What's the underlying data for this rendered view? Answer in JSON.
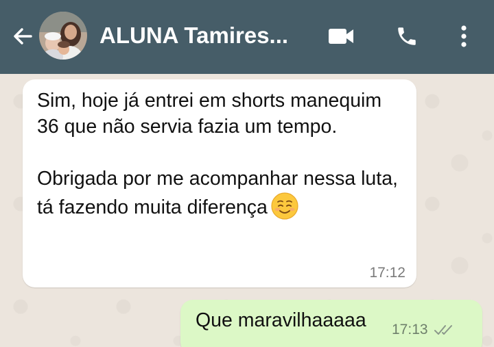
{
  "header": {
    "contact_name": "ALUNA Tamires...",
    "background_color": "#465d68",
    "icons": [
      "back-arrow-icon",
      "avatar",
      "video-camera-icon",
      "phone-icon",
      "more-vertical-icon"
    ]
  },
  "messages": [
    {
      "direction": "incoming",
      "paragraphs": [
        "Sim, hoje já entrei em shorts manequim 36 que não servia fazia um tempo.",
        "Obrigada por me acompanhar nessa luta, tá fazendo muita diferença"
      ],
      "emoji": "smiling-face-icon",
      "time": "17:12"
    },
    {
      "direction": "outgoing",
      "text": "Que maravilhaaaaa",
      "time": "17:13",
      "status": "double-check-icon"
    }
  ],
  "colors": {
    "incoming_bubble": "#ffffff",
    "outgoing_bubble": "#dcf8c6",
    "wallpaper": "#ece5dd"
  }
}
